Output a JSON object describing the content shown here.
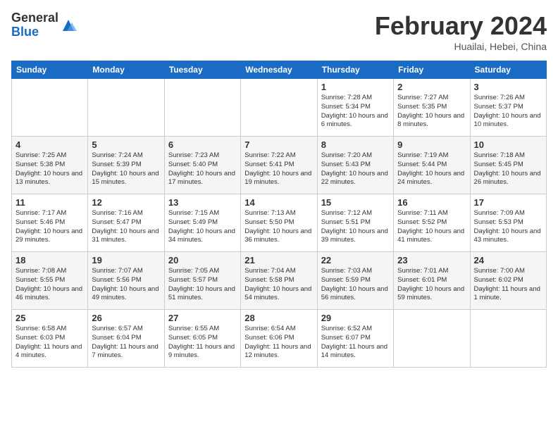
{
  "header": {
    "logo_general": "General",
    "logo_blue": "Blue",
    "title": "February 2024",
    "location": "Huailai, Hebei, China"
  },
  "days_of_week": [
    "Sunday",
    "Monday",
    "Tuesday",
    "Wednesday",
    "Thursday",
    "Friday",
    "Saturday"
  ],
  "weeks": [
    [
      {
        "day": "",
        "info": ""
      },
      {
        "day": "",
        "info": ""
      },
      {
        "day": "",
        "info": ""
      },
      {
        "day": "",
        "info": ""
      },
      {
        "day": "1",
        "info": "Sunrise: 7:28 AM\nSunset: 5:34 PM\nDaylight: 10 hours\nand 6 minutes."
      },
      {
        "day": "2",
        "info": "Sunrise: 7:27 AM\nSunset: 5:35 PM\nDaylight: 10 hours\nand 8 minutes."
      },
      {
        "day": "3",
        "info": "Sunrise: 7:26 AM\nSunset: 5:37 PM\nDaylight: 10 hours\nand 10 minutes."
      }
    ],
    [
      {
        "day": "4",
        "info": "Sunrise: 7:25 AM\nSunset: 5:38 PM\nDaylight: 10 hours\nand 13 minutes."
      },
      {
        "day": "5",
        "info": "Sunrise: 7:24 AM\nSunset: 5:39 PM\nDaylight: 10 hours\nand 15 minutes."
      },
      {
        "day": "6",
        "info": "Sunrise: 7:23 AM\nSunset: 5:40 PM\nDaylight: 10 hours\nand 17 minutes."
      },
      {
        "day": "7",
        "info": "Sunrise: 7:22 AM\nSunset: 5:41 PM\nDaylight: 10 hours\nand 19 minutes."
      },
      {
        "day": "8",
        "info": "Sunrise: 7:20 AM\nSunset: 5:43 PM\nDaylight: 10 hours\nand 22 minutes."
      },
      {
        "day": "9",
        "info": "Sunrise: 7:19 AM\nSunset: 5:44 PM\nDaylight: 10 hours\nand 24 minutes."
      },
      {
        "day": "10",
        "info": "Sunrise: 7:18 AM\nSunset: 5:45 PM\nDaylight: 10 hours\nand 26 minutes."
      }
    ],
    [
      {
        "day": "11",
        "info": "Sunrise: 7:17 AM\nSunset: 5:46 PM\nDaylight: 10 hours\nand 29 minutes."
      },
      {
        "day": "12",
        "info": "Sunrise: 7:16 AM\nSunset: 5:47 PM\nDaylight: 10 hours\nand 31 minutes."
      },
      {
        "day": "13",
        "info": "Sunrise: 7:15 AM\nSunset: 5:49 PM\nDaylight: 10 hours\nand 34 minutes."
      },
      {
        "day": "14",
        "info": "Sunrise: 7:13 AM\nSunset: 5:50 PM\nDaylight: 10 hours\nand 36 minutes."
      },
      {
        "day": "15",
        "info": "Sunrise: 7:12 AM\nSunset: 5:51 PM\nDaylight: 10 hours\nand 39 minutes."
      },
      {
        "day": "16",
        "info": "Sunrise: 7:11 AM\nSunset: 5:52 PM\nDaylight: 10 hours\nand 41 minutes."
      },
      {
        "day": "17",
        "info": "Sunrise: 7:09 AM\nSunset: 5:53 PM\nDaylight: 10 hours\nand 43 minutes."
      }
    ],
    [
      {
        "day": "18",
        "info": "Sunrise: 7:08 AM\nSunset: 5:55 PM\nDaylight: 10 hours\nand 46 minutes."
      },
      {
        "day": "19",
        "info": "Sunrise: 7:07 AM\nSunset: 5:56 PM\nDaylight: 10 hours\nand 49 minutes."
      },
      {
        "day": "20",
        "info": "Sunrise: 7:05 AM\nSunset: 5:57 PM\nDaylight: 10 hours\nand 51 minutes."
      },
      {
        "day": "21",
        "info": "Sunrise: 7:04 AM\nSunset: 5:58 PM\nDaylight: 10 hours\nand 54 minutes."
      },
      {
        "day": "22",
        "info": "Sunrise: 7:03 AM\nSunset: 5:59 PM\nDaylight: 10 hours\nand 56 minutes."
      },
      {
        "day": "23",
        "info": "Sunrise: 7:01 AM\nSunset: 6:01 PM\nDaylight: 10 hours\nand 59 minutes."
      },
      {
        "day": "24",
        "info": "Sunrise: 7:00 AM\nSunset: 6:02 PM\nDaylight: 11 hours\nand 1 minute."
      }
    ],
    [
      {
        "day": "25",
        "info": "Sunrise: 6:58 AM\nSunset: 6:03 PM\nDaylight: 11 hours\nand 4 minutes."
      },
      {
        "day": "26",
        "info": "Sunrise: 6:57 AM\nSunset: 6:04 PM\nDaylight: 11 hours\nand 7 minutes."
      },
      {
        "day": "27",
        "info": "Sunrise: 6:55 AM\nSunset: 6:05 PM\nDaylight: 11 hours\nand 9 minutes."
      },
      {
        "day": "28",
        "info": "Sunrise: 6:54 AM\nSunset: 6:06 PM\nDaylight: 11 hours\nand 12 minutes."
      },
      {
        "day": "29",
        "info": "Sunrise: 6:52 AM\nSunset: 6:07 PM\nDaylight: 11 hours\nand 14 minutes."
      },
      {
        "day": "",
        "info": ""
      },
      {
        "day": "",
        "info": ""
      }
    ]
  ]
}
